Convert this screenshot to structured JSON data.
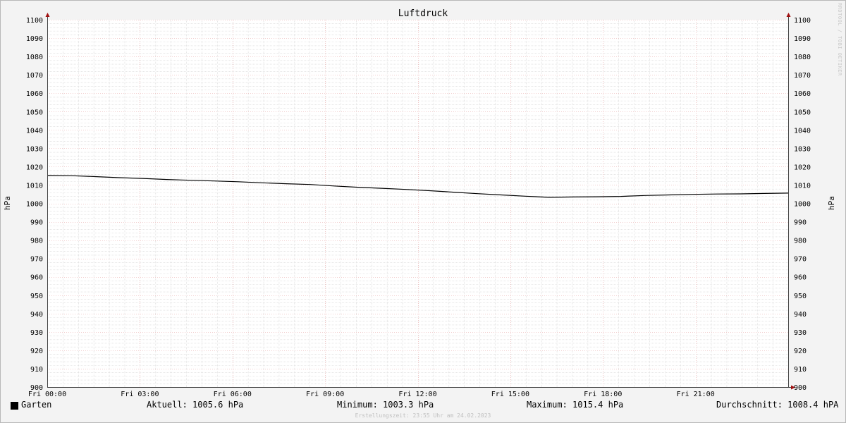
{
  "chart_data": {
    "type": "line",
    "title": "Luftdruck",
    "ylabel": "hPa",
    "ylabel_right": "hPa",
    "ylim": [
      900,
      1100
    ],
    "ytick_step": 10,
    "grid": true,
    "xticks": [
      "Fri 00:00",
      "Fri 03:00",
      "Fri 06:00",
      "Fri 09:00",
      "Fri 12:00",
      "Fri 15:00",
      "Fri 18:00",
      "Fri 21:00"
    ],
    "x_hours": [
      0,
      1,
      2,
      3,
      4,
      5,
      6,
      7,
      8,
      9,
      10,
      11,
      12,
      13,
      14,
      15,
      16,
      17,
      18,
      19,
      20,
      21,
      22,
      23,
      24
    ],
    "series": [
      {
        "name": "Garten",
        "color": "#000000",
        "values": [
          1015.2,
          1015.1,
          1014.6,
          1014.0,
          1013.6,
          1013.0,
          1012.6,
          1012.2,
          1011.8,
          1011.2,
          1010.7,
          1010.3,
          1009.5,
          1008.8,
          1008.2,
          1007.6,
          1006.9,
          1006.1,
          1005.3,
          1004.6,
          1003.9,
          1003.3,
          1003.5,
          1003.6,
          1003.8,
          1004.3,
          1004.6,
          1004.9,
          1005.1,
          1005.2,
          1005.4,
          1005.6
        ]
      }
    ]
  },
  "legend": {
    "series_name": "Garten",
    "aktuell": "Aktuell: 1005.6 hPa",
    "minimum": "Minimum: 1003.3 hPa",
    "maximum": "Maximum: 1015.4 hPa",
    "durchschnitt": "Durchschnitt: 1008.4 hPA"
  },
  "footer": "Erstellungszeit: 23:55 Uhr am 24.02.2023",
  "watermark": "RRDTOOL / TOBI OETIKER"
}
